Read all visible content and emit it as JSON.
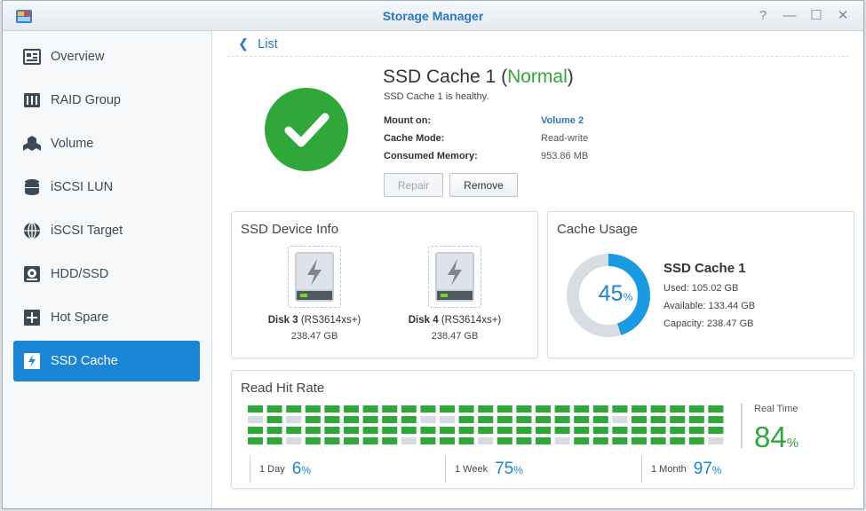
{
  "window": {
    "title": "Storage Manager",
    "controls": [
      "?",
      "—",
      "☐",
      "✕"
    ]
  },
  "sidebar": {
    "items": [
      {
        "label": "Overview",
        "icon": "overview-icon"
      },
      {
        "label": "RAID Group",
        "icon": "raid-group-icon"
      },
      {
        "label": "Volume",
        "icon": "volume-icon"
      },
      {
        "label": "iSCSI LUN",
        "icon": "iscsi-lun-icon"
      },
      {
        "label": "iSCSI Target",
        "icon": "iscsi-target-icon"
      },
      {
        "label": "HDD/SSD",
        "icon": "hdd-ssd-icon"
      },
      {
        "label": "Hot Spare",
        "icon": "hot-spare-icon"
      },
      {
        "label": "SSD Cache",
        "icon": "ssd-cache-icon",
        "active": true
      }
    ]
  },
  "main": {
    "back_label": "List",
    "cache": {
      "name": "SSD Cache 1",
      "status_open": "(",
      "status": "Normal",
      "status_close": ")",
      "subtitle": "SSD Cache 1 is healthy.",
      "details": [
        {
          "key": "Mount on:",
          "value": "Volume 2",
          "link": true
        },
        {
          "key": "Cache Mode:",
          "value": "Read-write",
          "link": false
        },
        {
          "key": "Consumed Memory:",
          "value": "953.86 MB",
          "link": false
        }
      ]
    },
    "buttons": {
      "repair": "Repair",
      "remove": "Remove"
    },
    "device_info": {
      "title": "SSD Device Info",
      "disks": [
        {
          "name": "Disk 3",
          "model": " (RS3614xs+)",
          "size": "238.47 GB"
        },
        {
          "name": "Disk 4",
          "model": " (RS3614xs+)",
          "size": "238.47 GB"
        }
      ]
    },
    "cache_usage": {
      "title": "Cache Usage",
      "name": "SSD Cache 1",
      "percent": 45,
      "percent_text": "45",
      "percent_sign": "%",
      "used": "Used: 105.02 GB",
      "available": "Available: 133.44 GB",
      "capacity": "Capacity: 238.47 GB",
      "colors": {
        "used": "#1b9ae4",
        "free": "#d7dde3"
      }
    },
    "read_hit_rate": {
      "title": "Read Hit Rate",
      "grid": [
        "1111111111111111111111111",
        "0101111110011111111011111",
        "1111111111111111111111111",
        "1101111101110111011111110"
      ],
      "colors": {
        "hit": "#2fa739",
        "miss": "#d5dbe1"
      },
      "realtime_label": "Real Time",
      "realtime_value": "84",
      "realtime_unit": "%",
      "stats": [
        {
          "label": "1 Day",
          "value": "6",
          "unit": "%"
        },
        {
          "label": "1 Week",
          "value": "75",
          "unit": "%"
        },
        {
          "label": "1 Month",
          "value": "97",
          "unit": "%"
        }
      ]
    }
  }
}
